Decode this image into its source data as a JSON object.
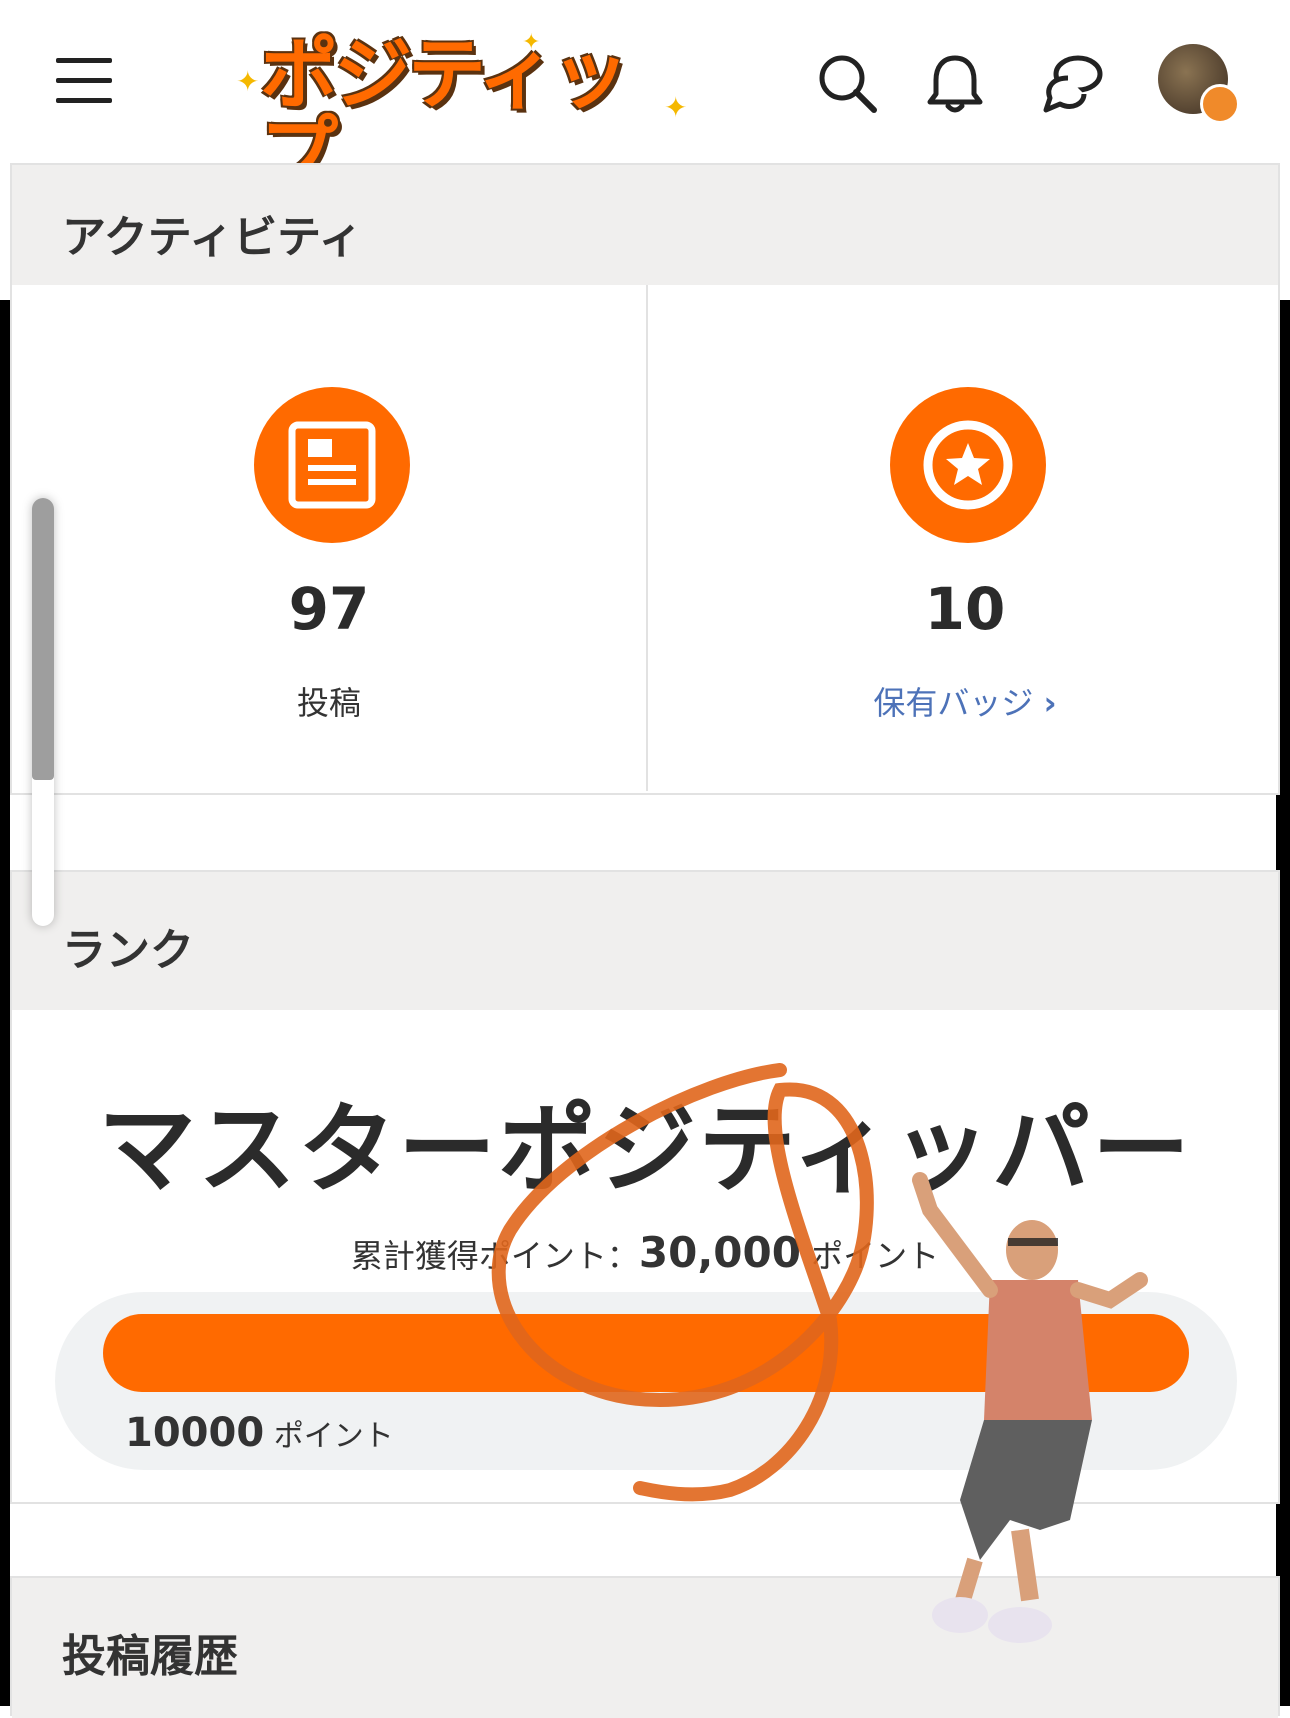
{
  "header": {
    "logo_text": "ポジティップ",
    "icons": [
      "menu-icon",
      "search-icon",
      "bell-icon",
      "chat-icon",
      "avatar"
    ]
  },
  "activity": {
    "title": "アクティビティ",
    "posts": {
      "value": "97",
      "label": "投稿",
      "icon": "article-icon"
    },
    "badges": {
      "value": "10",
      "label": "保有バッジ",
      "icon": "star-badge-icon"
    }
  },
  "rank": {
    "title": "ランク",
    "name": "マスターポジティッパー",
    "points_prefix": "累計獲得ポイント：",
    "points_value": "30,000",
    "points_unit": "ポイント",
    "bar_label_value": "10000",
    "bar_label_unit": "ポイント",
    "progress_fraction": 1.0
  },
  "history": {
    "title": "投稿履歴"
  },
  "colors": {
    "accent": "#ff6a00",
    "link": "#4d72b8",
    "section_bg": "#f0efee"
  }
}
